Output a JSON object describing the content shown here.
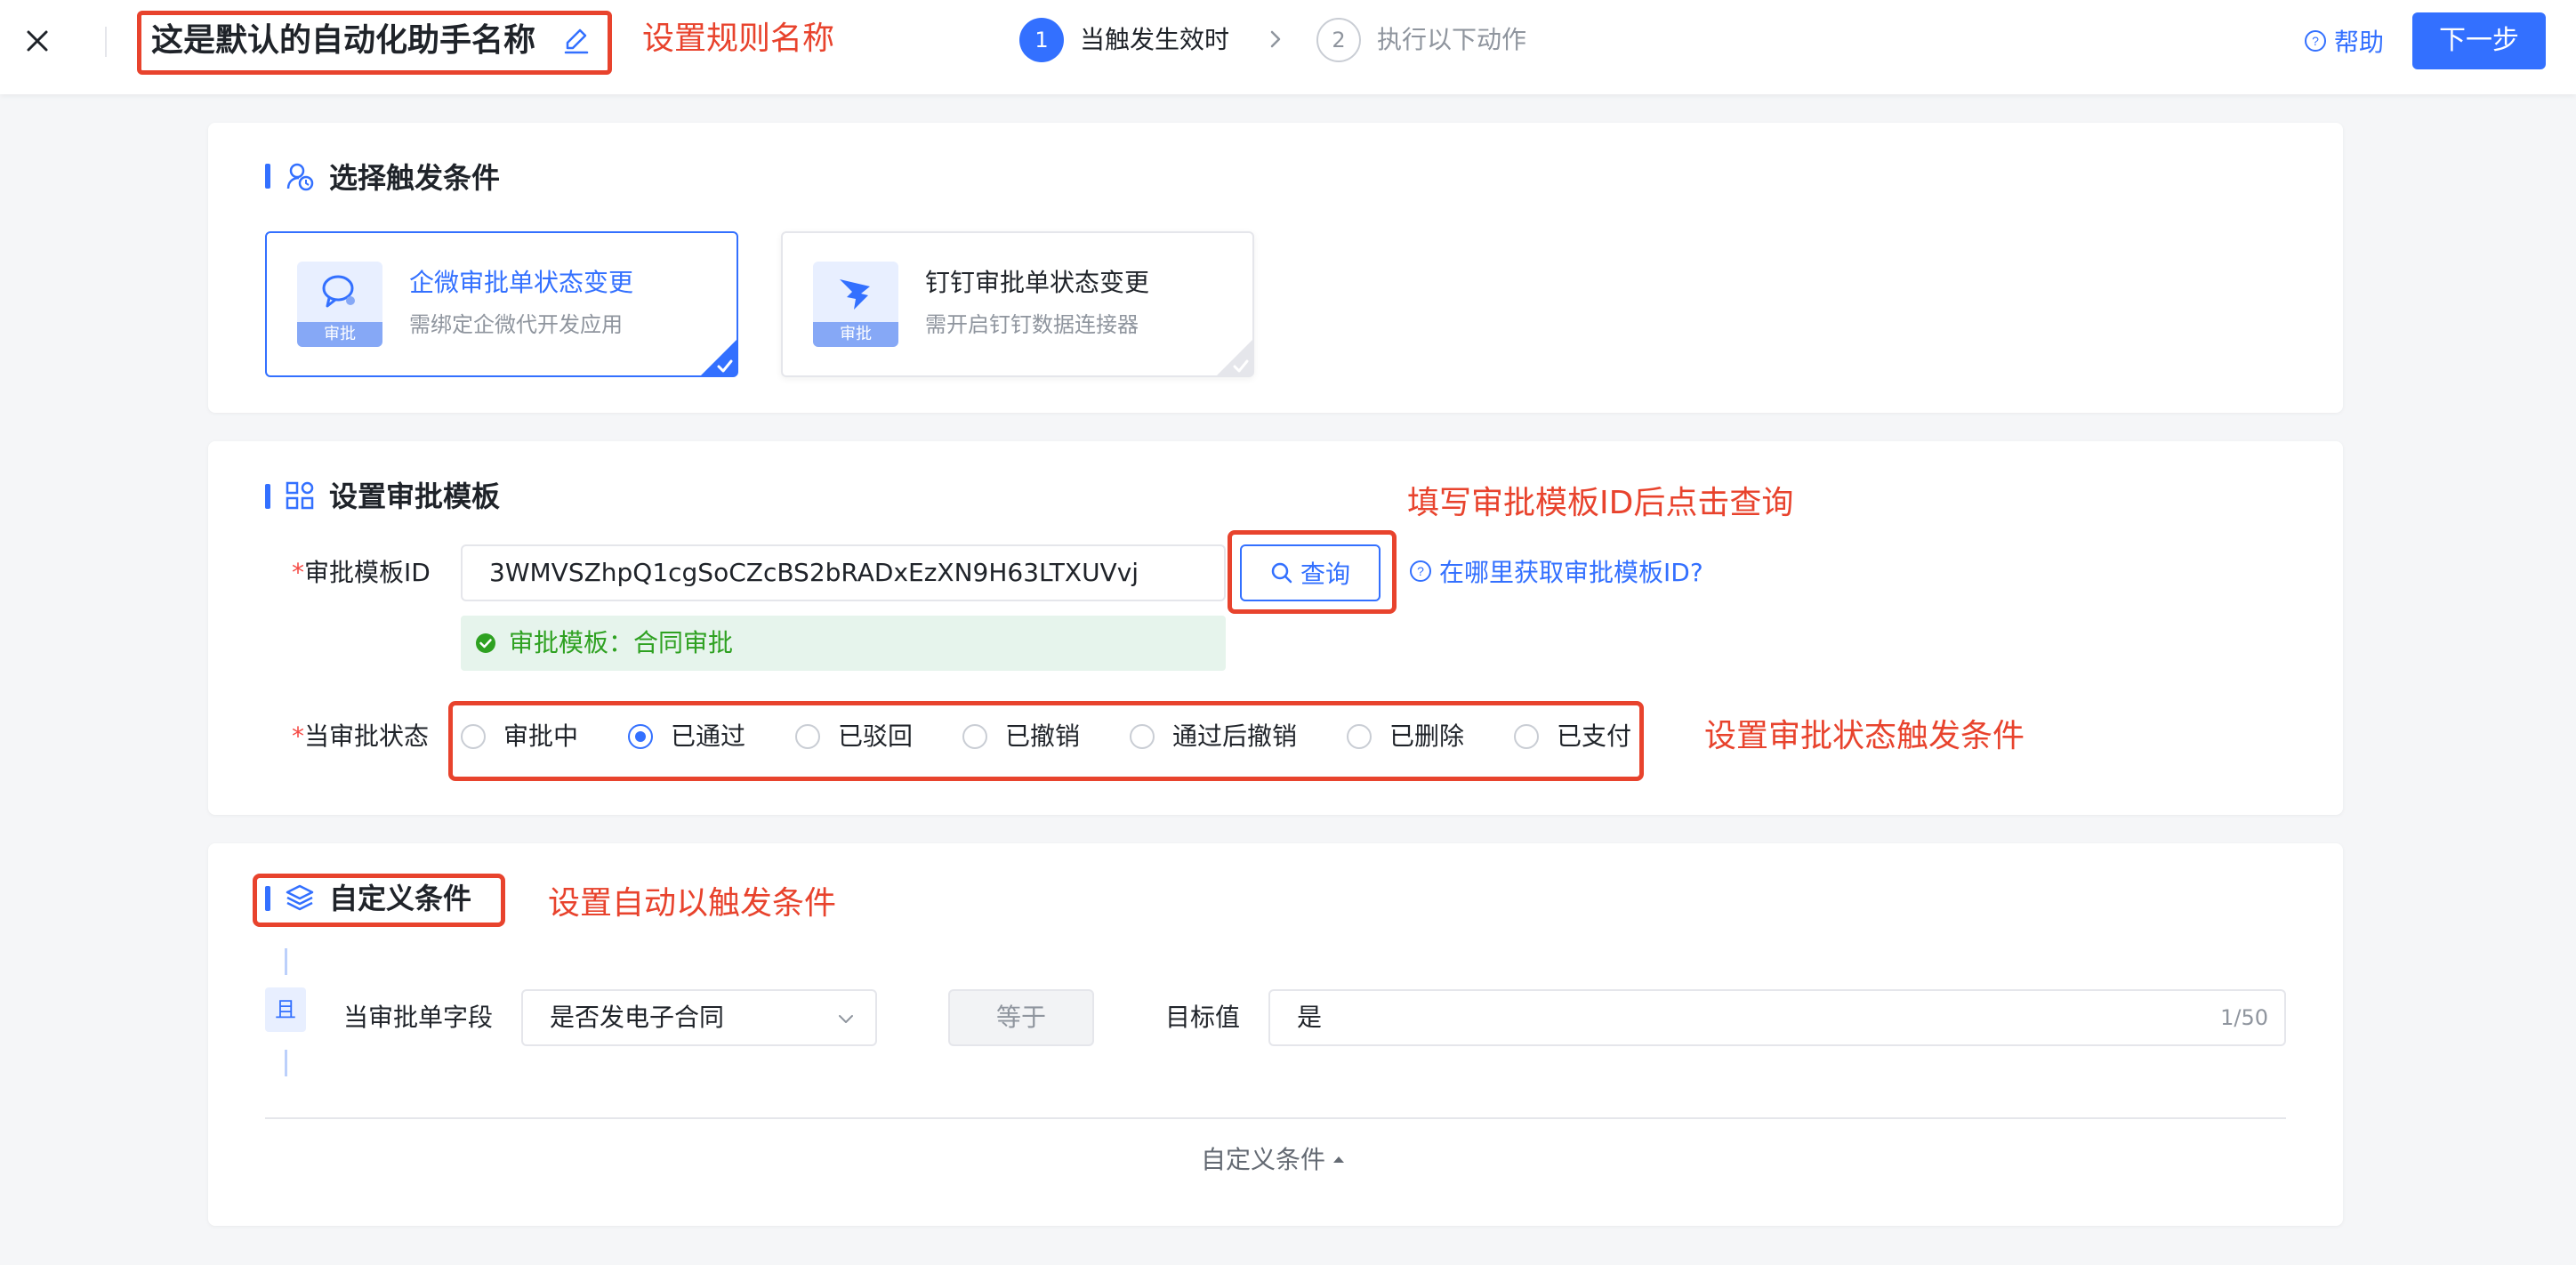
{
  "header": {
    "rule_name": "这是默认的自动化助手名称",
    "annotation_rule_name": "设置规则名称",
    "steps": [
      {
        "num": "1",
        "label": "当触发生效时"
      },
      {
        "num": "2",
        "label": "执行以下动作"
      }
    ],
    "help_label": "帮助",
    "next_label": "下一步"
  },
  "trigger_section": {
    "title": "选择触发条件",
    "cards": [
      {
        "title": "企微审批单状态变更",
        "subtitle": "需绑定企微代开发应用",
        "badge": "审批",
        "selected": true
      },
      {
        "title": "钉钉审批单状态变更",
        "subtitle": "需开启钉钉数据连接器",
        "badge": "审批",
        "selected": false
      }
    ]
  },
  "template_section": {
    "title": "设置审批模板",
    "annotation_query": "填写审批模板ID后点击查询",
    "id_label": "审批模板ID",
    "required_mark": "*",
    "id_value": "3WMVSZhpQ1cgSoCZcBS2bRADxEzXN9H63LTXUVvj",
    "query_label": "查询",
    "where_link": "在哪里获取审批模板ID?",
    "result_text": "审批模板：合同审批",
    "status_label": "当审批状态",
    "status_options": [
      "审批中",
      "已通过",
      "已驳回",
      "已撤销",
      "通过后撤销",
      "已删除",
      "已支付"
    ],
    "status_selected": "已通过",
    "annotation_status": "设置审批状态触发条件"
  },
  "custom_section": {
    "title": "自定义条件",
    "annotation": "设置自动以触发条件",
    "and_tag": "且",
    "field_label": "当审批单字段",
    "field_value": "是否发电子合同",
    "operator": "等于",
    "target_label": "目标值",
    "target_value": "是",
    "counter": "1/50",
    "collapse_label": "自定义条件"
  },
  "colors": {
    "primary": "#3370ff",
    "annotation_red": "#e8432d",
    "success": "#2ea121"
  },
  "icons": [
    "close-icon",
    "edit-icon",
    "chevron-right-icon",
    "help-icon",
    "trigger-icon",
    "template-icon",
    "layers-icon",
    "search-icon",
    "check-circle-icon",
    "chevron-down-icon",
    "caret-up-icon"
  ]
}
